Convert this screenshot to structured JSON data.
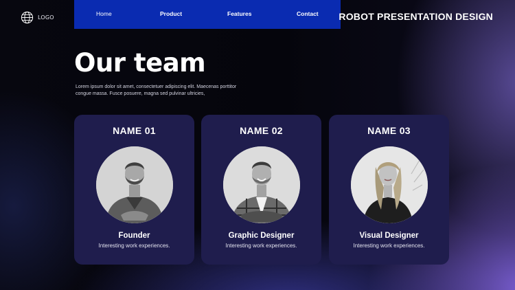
{
  "logo": {
    "label": "LOGO",
    "icon": "globe-icon"
  },
  "nav": {
    "items": [
      {
        "label": "Home"
      },
      {
        "label": "Product"
      },
      {
        "label": "Features"
      },
      {
        "label": "Contact"
      }
    ]
  },
  "header": {
    "title": "ROBOT PRESENTATION DESIGN"
  },
  "main": {
    "title": "Our team",
    "description": "Lorem ipsum dolor sit amet, consectetuer adipiscing elit. Maecenas porttitor congue massa. Fusce posuere, magna sed pulvinar ultricies,"
  },
  "team": [
    {
      "name": "NAME 01",
      "role": "Founder",
      "subtitle": "Interesting work experiences."
    },
    {
      "name": "NAME 02",
      "role": "Graphic Designer",
      "subtitle": "Interesting work experiences."
    },
    {
      "name": "NAME 03",
      "role": "Visual Designer",
      "subtitle": "Interesting work experiences."
    }
  ],
  "colors": {
    "nav_background": "#0a2bb1",
    "card_background": "#1f1d4d",
    "page_background": "#060611",
    "accent_glow": "#7c60d6"
  }
}
